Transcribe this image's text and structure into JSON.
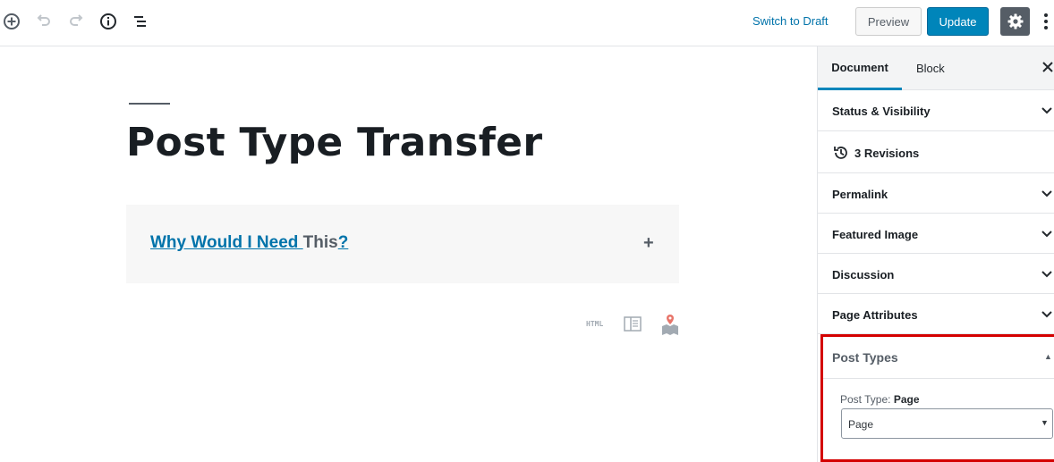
{
  "toolbar": {
    "icons": [
      "add-block-icon",
      "undo-icon",
      "redo-icon",
      "info-icon",
      "block-navigation-icon"
    ],
    "switch_to_draft": "Switch to Draft",
    "preview": "Preview",
    "update": "Update",
    "settings_icon": "gear-icon",
    "more_icon": "more-vertical-icon"
  },
  "editor": {
    "title": "Post Type Transfer",
    "accordion": {
      "link_text": "Why Would I Need ",
      "plain_text": "This",
      "link_text_2": "?",
      "toggle": "+"
    },
    "block_icons": {
      "html": "HTML",
      "icons": [
        "html-icon",
        "book-icon",
        "map-icon"
      ]
    }
  },
  "sidebar": {
    "tabs": {
      "document": "Document",
      "block": "Block"
    },
    "close_icon": "close-icon",
    "panels": [
      {
        "label": "Status & Visibility",
        "icon": "chevron-down-icon"
      },
      {
        "label": "3 Revisions",
        "icon": "history-icon"
      },
      {
        "label": "Permalink",
        "icon": "chevron-down-icon"
      },
      {
        "label": "Featured Image",
        "icon": "chevron-down-icon"
      },
      {
        "label": "Discussion",
        "icon": "chevron-down-icon"
      },
      {
        "label": "Page Attributes",
        "icon": "chevron-down-icon"
      }
    ],
    "post_types": {
      "header": "Post Types",
      "arrow": "▲",
      "label_prefix": "Post Type: ",
      "label_value": "Page",
      "select_value": "Page",
      "select_arrow": "▼"
    }
  },
  "colors": {
    "accent": "#0085ba",
    "link": "#0073aa",
    "highlight_border": "#d40000"
  }
}
